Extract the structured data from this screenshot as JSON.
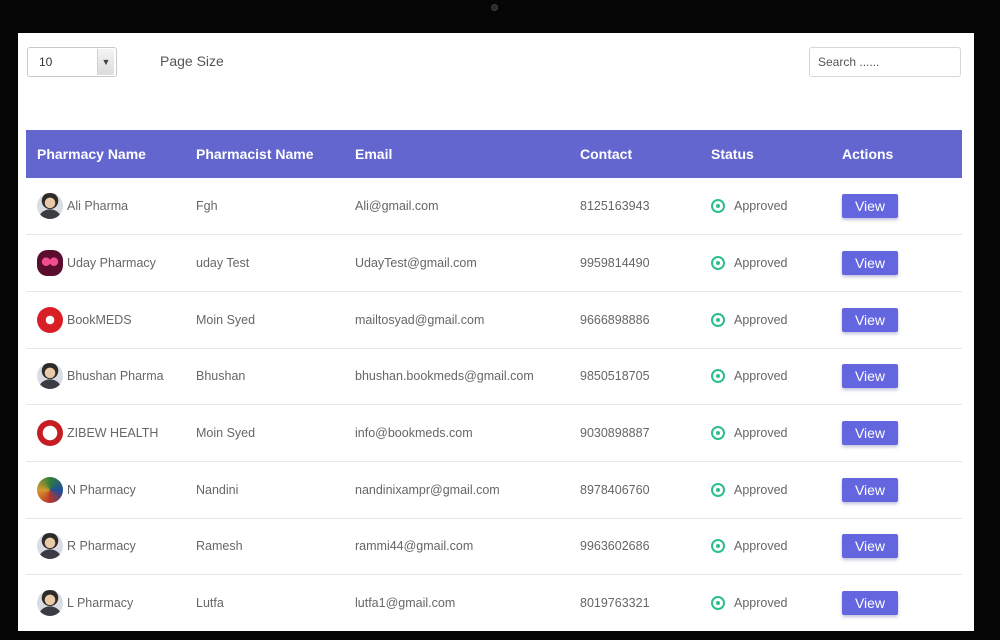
{
  "controls": {
    "page_size_value": "10",
    "page_size_label": "Page Size",
    "search_placeholder": "Search ......"
  },
  "table": {
    "headers": [
      "Pharmacy Name",
      "Pharmacist Name",
      "Email",
      "Contact",
      "Status",
      "Actions"
    ],
    "view_label": "View",
    "rows": [
      {
        "pharmacy": "Ali Pharma",
        "pharmacist": "Fgh",
        "email": "Ali@gmail.com",
        "contact": "8125163943",
        "status": "Approved",
        "avatar": "person"
      },
      {
        "pharmacy": "Uday Pharmacy",
        "pharmacist": "uday Test",
        "email": "UdayTest@gmail.com",
        "contact": "9959814490",
        "status": "Approved",
        "avatar": "mask"
      },
      {
        "pharmacy": "BookMEDS",
        "pharmacist": "Moin Syed",
        "email": "mailtosyad@gmail.com",
        "contact": "9666898886",
        "status": "Approved",
        "avatar": "red-circle"
      },
      {
        "pharmacy": "Bhushan Pharma",
        "pharmacist": "Bhushan",
        "email": "bhushan.bookmeds@gmail.com",
        "contact": "9850518705",
        "status": "Approved",
        "avatar": "person"
      },
      {
        "pharmacy": "ZIBEW HEALTH",
        "pharmacist": "Moin Syed",
        "email": "info@bookmeds.com",
        "contact": "9030898887",
        "status": "Approved",
        "avatar": "zibew"
      },
      {
        "pharmacy": "N Pharmacy",
        "pharmacist": "Nandini",
        "email": "nandinixampr@gmail.com",
        "contact": "8978406760",
        "status": "Approved",
        "avatar": "colorful"
      },
      {
        "pharmacy": "R Pharmacy",
        "pharmacist": "Ramesh",
        "email": "rammi44@gmail.com",
        "contact": "9963602686",
        "status": "Approved",
        "avatar": "person"
      },
      {
        "pharmacy": "L Pharmacy",
        "pharmacist": "Lutfa",
        "email": "lutfa1@gmail.com",
        "contact": "8019763321",
        "status": "Approved",
        "avatar": "person"
      }
    ]
  },
  "colors": {
    "header_bg": "#6466cf",
    "button_bg": "#6466e0",
    "approved": "#2bbf8a"
  }
}
